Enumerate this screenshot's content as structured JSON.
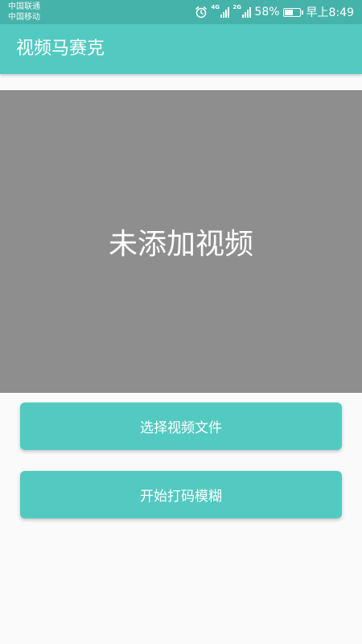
{
  "status_bar": {
    "carrier_1": "中国联通",
    "carrier_2": "中国移动",
    "network_1": "4G",
    "network_2": "2G",
    "battery_percent": "58%",
    "battery_level": 0.58,
    "time": "早上8:49"
  },
  "app_bar": {
    "title": "视频马赛克"
  },
  "video_area": {
    "placeholder": "未添加视频"
  },
  "buttons": {
    "select_label": "选择视频文件",
    "start_label": "开始打码模糊"
  },
  "colors": {
    "accent": "#53cac1",
    "status_bar": "#46b3aa",
    "video_background": "#8e8e8e",
    "page_background": "#fafafa"
  },
  "icons": {
    "alarm": "alarm-clock-icon",
    "signal": "signal-strength-icon",
    "battery": "battery-icon"
  }
}
